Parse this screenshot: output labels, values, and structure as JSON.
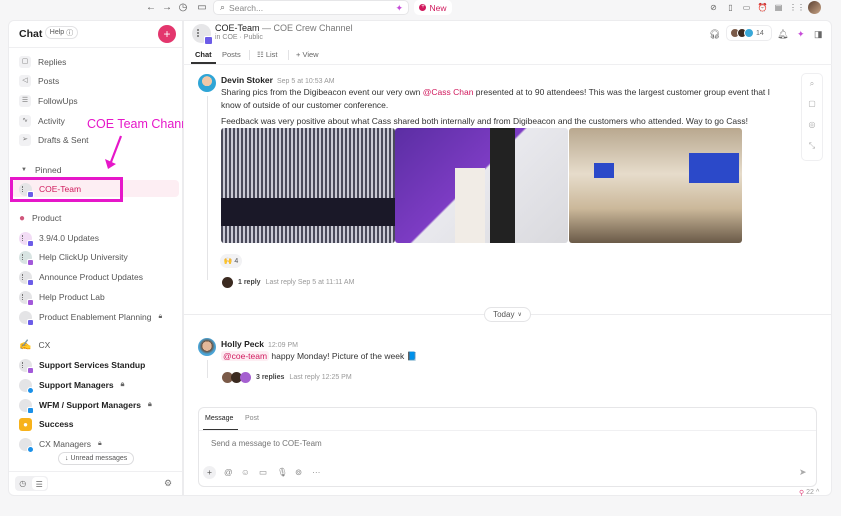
{
  "topbar": {
    "search_placeholder": "Search...",
    "new_label": "New",
    "icons": [
      "back-arrow",
      "forward-arrow",
      "history",
      "calendar",
      "ai-sparkle",
      "check-circle",
      "notepad",
      "video",
      "alarm-clock",
      "document",
      "app-grid",
      "user-avatar"
    ]
  },
  "sidebar": {
    "title": "Chat",
    "help_label": "Help",
    "nav": [
      {
        "label": "Replies",
        "icon": "comment-icon"
      },
      {
        "label": "Posts",
        "icon": "megaphone-icon"
      },
      {
        "label": "FollowUps",
        "icon": "checklist-icon"
      },
      {
        "label": "Activity",
        "icon": "activity-icon"
      },
      {
        "label": "Drafts & Sent",
        "icon": "send-icon"
      }
    ],
    "pinned_label": "Pinned",
    "channels": [
      {
        "label": "COE-Team",
        "active": true
      },
      {
        "label": "Product",
        "type": "section"
      },
      {
        "label": "3.9/4.0 Updates"
      },
      {
        "label": "Help ClickUp University"
      },
      {
        "label": "Announce Product Updates"
      },
      {
        "label": "Help Product Lab"
      },
      {
        "label": "Product Enablement Planning",
        "locked": true
      },
      {
        "label": "CX",
        "type": "section"
      },
      {
        "label": "Support Services Standup",
        "unread": true
      },
      {
        "label": "Support Managers",
        "unread": true,
        "locked": true
      },
      {
        "label": "WFM / Support Managers",
        "unread": true,
        "locked": true
      },
      {
        "label": "Success",
        "unread": true
      },
      {
        "label": "CX Managers",
        "locked": true
      }
    ],
    "unread_button": "↓ Unread messages"
  },
  "annotation": {
    "label": "COE Team Channel",
    "color": "#e617c9"
  },
  "channel": {
    "name": "COE-Team",
    "description": "— COE Crew Channel",
    "location": "in COE · Public",
    "tabs": [
      "Chat",
      "Posts",
      "List",
      "+ View"
    ],
    "active_tab": "Chat",
    "member_count": "14"
  },
  "messages": [
    {
      "author": "Devin Stoker",
      "time": "Sep 5 at 10:53 AM",
      "text_before": "Sharing pics from the Digibeacon event our very own ",
      "mention": "@Cass Chan",
      "text_after": " presented at to 90 attendees!  This was the largest customer group event that I know of outside of our customer conference.",
      "text2": "Feedback was very positive about what Cass shared both internally and from Digibeacon and the customers who attended.  Way to go Cass!",
      "photos": [
        "slides-on-screen",
        "presenter-at-podium",
        "conference-room"
      ],
      "reaction": {
        "emoji": "🙌",
        "count": "4"
      },
      "replies": "1 reply",
      "last_reply": "Last reply Sep 5 at 11:11 AM"
    },
    {
      "author": "Holly Peck",
      "time": "12:09 PM",
      "mention": "@coe-team",
      "text": " happy Monday! Picture of the week ",
      "emoji": "📘",
      "replies": "3 replies",
      "last_reply": "Last reply 12:25 PM"
    }
  ],
  "divider": {
    "label": "Today"
  },
  "composer": {
    "tabs": [
      "Message",
      "Post"
    ],
    "active_tab": "Message",
    "placeholder": "Send a message to COE-Team"
  },
  "bottom_badge": {
    "count": "22"
  },
  "colors": {
    "accent": "#d0185c",
    "plus_button": "#e3366d",
    "annotation": "#e617c9"
  }
}
